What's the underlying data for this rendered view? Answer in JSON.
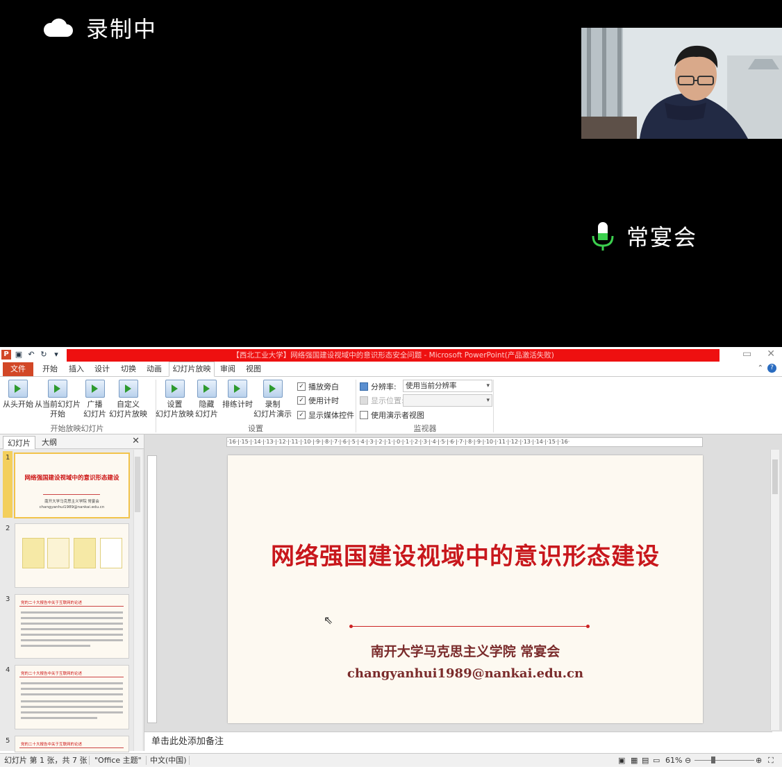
{
  "meeting": {
    "recording_label": "录制中",
    "speaker_name": "常宴会"
  },
  "window": {
    "title": "【西北工业大学】网络强国建设视域中的意识形态安全问题 - Microsoft PowerPoint(产品激活失败)",
    "app_icon": "P"
  },
  "tabs": [
    "文件",
    "开始",
    "插入",
    "设计",
    "切换",
    "动画",
    "幻灯片放映",
    "审阅",
    "视图"
  ],
  "active_tab": "幻灯片放映",
  "ribbon": {
    "start_group": {
      "from_beginning": "从头开始",
      "from_current_1": "从当前幻灯片",
      "from_current_2": "开始",
      "broadcast_1": "广播",
      "broadcast_2": "幻灯片",
      "custom_1": "自定义",
      "custom_2": "幻灯片放映",
      "label": "开始放映幻灯片"
    },
    "setup_group": {
      "setup_1": "设置",
      "setup_2": "幻灯片放映",
      "hide_1": "隐藏",
      "hide_2": "幻灯片",
      "rehearse": "排练计时",
      "record_1": "录制",
      "record_2": "幻灯片演示",
      "play_narration": "播放旁白",
      "use_timings": "使用计时",
      "show_media": "显示媒体控件",
      "label": "设置"
    },
    "monitor_group": {
      "resolution_label": "分辨率:",
      "resolution_value": "使用当前分辨率",
      "show_on_label": "显示位置:",
      "presenter_view": "使用演示者视图",
      "label": "监视器"
    }
  },
  "left_panel": {
    "tab_slides": "幻灯片",
    "tab_outline": "大纲",
    "thumbs": [
      {
        "num": "1",
        "title": "网络强国建设视域中的意识形态建设",
        "line1": "南开大学马克思主义学院  常宴会",
        "line2": "changyanhui1989@nankai.edu.cn"
      },
      {
        "num": "2"
      },
      {
        "num": "3",
        "title": "党的二十大报告中关于互联网的论述"
      },
      {
        "num": "4",
        "title": "党的二十大报告中关于互联网的论述"
      },
      {
        "num": "5",
        "title": "党的二十大报告中关于互联网的论述"
      }
    ]
  },
  "ruler": "·16·|·15·|·14·|·13·|·12·|·11·|·10·|·9·|·8·|·7·|·6·|·5·|·4·|·3·|·2·|·1·|·0·|·1·|·2·|·3·|·4·|·5·|·6·|·7·|·8·|·9·|·10·|·11·|·12·|·13·|·14·|·15·|·16·",
  "slide": {
    "title": "网络强国建设视域中的意识形态建设",
    "author": "南开大学马克思主义学院   常宴会",
    "email": "changyanhui1989@nankai.edu.cn"
  },
  "notes_placeholder": "单击此处添加备注",
  "status": {
    "slide_info": "幻灯片 第 1 张，共 7 张",
    "theme": "\"Office 主题\"",
    "language": "中文(中国)",
    "zoom": "61%"
  },
  "colors": {
    "title_red": "#c8171c",
    "file_tab": "#d24726",
    "title_bar_red": "#ee1010"
  }
}
